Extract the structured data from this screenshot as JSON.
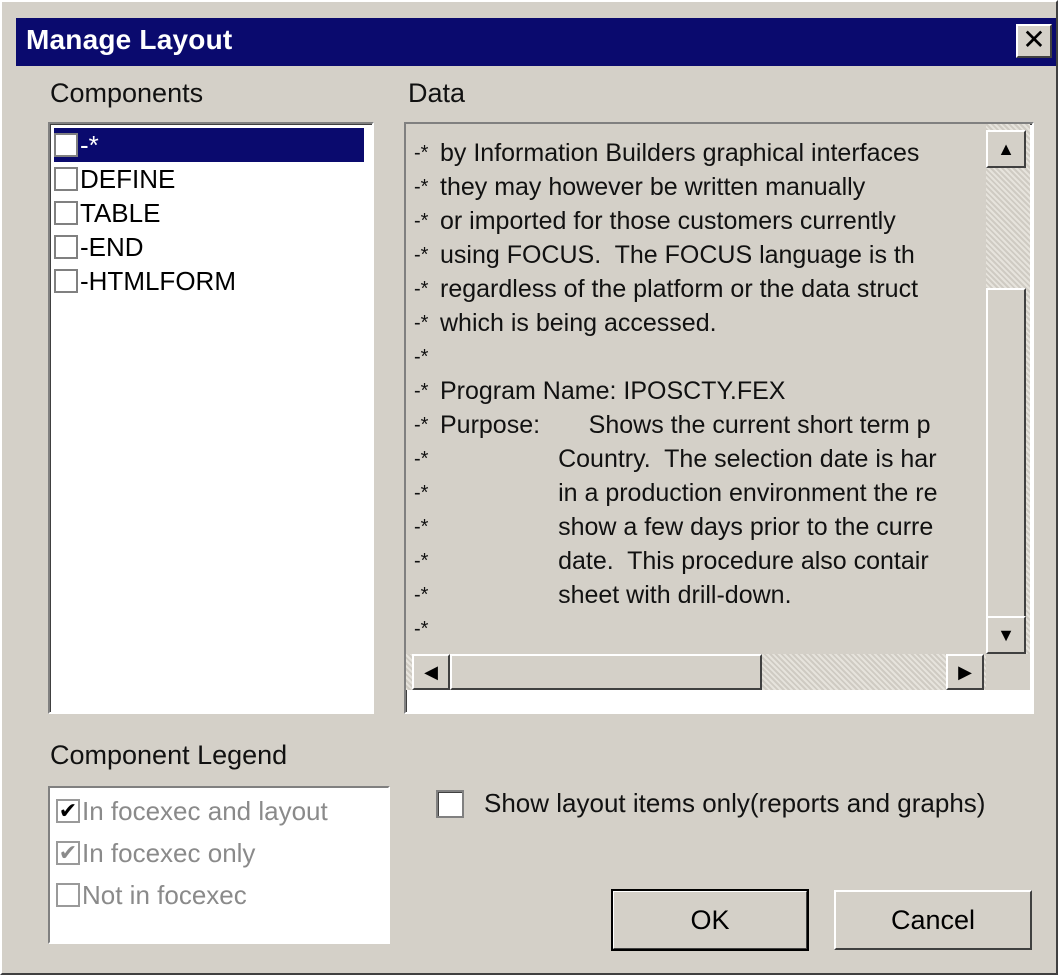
{
  "window": {
    "title": "Manage Layout",
    "close_glyph": "✕"
  },
  "components": {
    "label": "Components",
    "items": [
      {
        "label": "-*",
        "selected": true
      },
      {
        "label": "DEFINE",
        "selected": false
      },
      {
        "label": "TABLE",
        "selected": false
      },
      {
        "label": "-END",
        "selected": false
      },
      {
        "label": "-HTMLFORM",
        "selected": false
      }
    ]
  },
  "data_panel": {
    "label": "Data",
    "lines": [
      {
        "prefix": "-*",
        "text": "by Information Builders graphical interfaces"
      },
      {
        "prefix": "-*",
        "text": "they may however be written manually"
      },
      {
        "prefix": "-*",
        "text": "or imported for those customers currently"
      },
      {
        "prefix": "-*",
        "text": "using FOCUS.  The FOCUS language is th"
      },
      {
        "prefix": "-*",
        "text": "regardless of the platform or the data struct"
      },
      {
        "prefix": "-*",
        "text": "which is being accessed."
      },
      {
        "prefix": "-*",
        "text": ""
      },
      {
        "prefix": "-*",
        "text": "Program Name: IPOSCTY.FEX"
      },
      {
        "prefix": "-*",
        "text": "Purpose:       Shows the current short term p"
      },
      {
        "prefix": "-*",
        "text": "                 Country.  The selection date is har"
      },
      {
        "prefix": "-*",
        "text": "                 in a production environment the re"
      },
      {
        "prefix": "-*",
        "text": "                 show a few days prior to the curre"
      },
      {
        "prefix": "-*",
        "text": "                 date.  This procedure also contair"
      },
      {
        "prefix": "-*",
        "text": "                 sheet with drill-down."
      },
      {
        "prefix": "-*",
        "text": ""
      }
    ]
  },
  "legend": {
    "label": "Component Legend",
    "items": [
      {
        "label": "In focexec and layout",
        "state": "checked"
      },
      {
        "label": "In focexec only",
        "state": "checked-grey"
      },
      {
        "label": "Not in focexec",
        "state": "unchecked"
      }
    ]
  },
  "show_layout_only": {
    "label": "Show layout items only(reports and graphs)",
    "checked": false
  },
  "buttons": {
    "ok": "OK",
    "cancel": "Cancel"
  },
  "icons": {
    "scroll_up": "▲",
    "scroll_down": "▼",
    "scroll_left": "◀",
    "scroll_right": "▶",
    "check": "✔"
  }
}
